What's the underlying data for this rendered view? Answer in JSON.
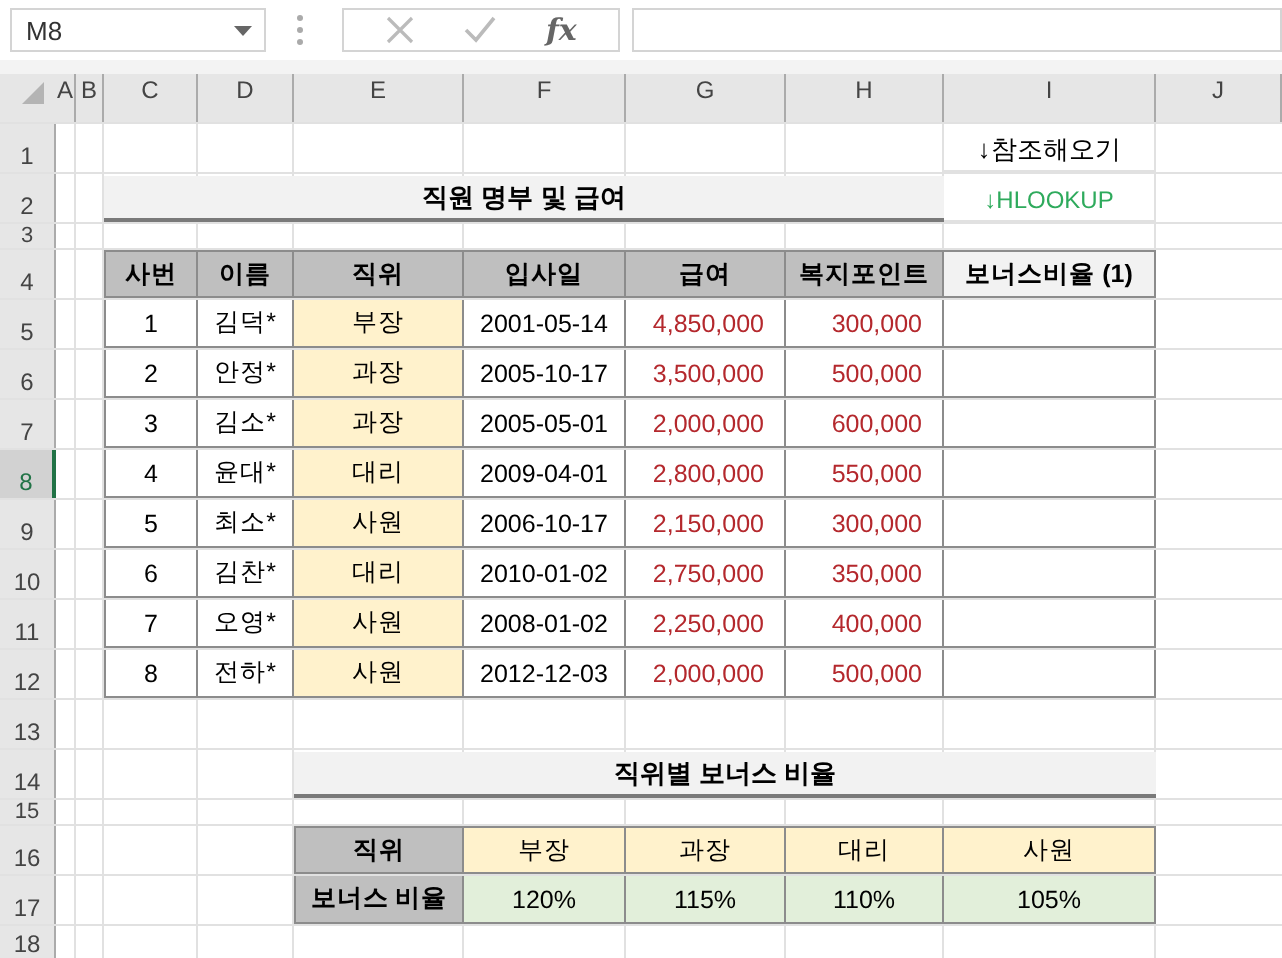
{
  "toolbar": {
    "name_box": "M8",
    "function_label": "fx"
  },
  "columns": [
    {
      "label": "A",
      "selected": false
    },
    {
      "label": "B",
      "selected": false
    },
    {
      "label": "C",
      "selected": false
    },
    {
      "label": "D",
      "selected": false
    },
    {
      "label": "E",
      "selected": false
    },
    {
      "label": "F",
      "selected": false
    },
    {
      "label": "G",
      "selected": false
    },
    {
      "label": "H",
      "selected": false
    },
    {
      "label": "I",
      "selected": false
    },
    {
      "label": "J",
      "selected": false
    }
  ],
  "rows": [
    {
      "label": "1",
      "selected": false
    },
    {
      "label": "2",
      "selected": false
    },
    {
      "label": "3",
      "selected": false
    },
    {
      "label": "4",
      "selected": false
    },
    {
      "label": "5",
      "selected": false
    },
    {
      "label": "6",
      "selected": false
    },
    {
      "label": "7",
      "selected": false
    },
    {
      "label": "8",
      "selected": true
    },
    {
      "label": "9",
      "selected": false
    },
    {
      "label": "10",
      "selected": false
    },
    {
      "label": "11",
      "selected": false
    },
    {
      "label": "12",
      "selected": false
    },
    {
      "label": "13",
      "selected": false
    },
    {
      "label": "14",
      "selected": false
    },
    {
      "label": "15",
      "selected": false
    },
    {
      "label": "16",
      "selected": false
    },
    {
      "label": "17",
      "selected": false
    },
    {
      "label": "18",
      "selected": false
    }
  ],
  "notes": [
    {
      "text": "↓참조해오기",
      "kind": "plain"
    },
    {
      "text": "↓HLOOKUP",
      "kind": "hint"
    }
  ],
  "staff_title": "직원 명부 및 급여",
  "staff_table": {
    "columns": [
      {
        "label": "사번",
        "kind": "number"
      },
      {
        "label": "이름",
        "kind": "name"
      },
      {
        "label": "직위",
        "kind": "position"
      },
      {
        "label": "입사일",
        "kind": "date"
      },
      {
        "label": "급여",
        "kind": "money"
      },
      {
        "label": "복지포인트",
        "kind": "money"
      },
      {
        "label": "보너스비율 (1)",
        "kind": "result"
      }
    ],
    "rows": [
      [
        "1",
        "김덕*",
        "부장",
        "2001-05-14",
        "4,850,000",
        "300,000"
      ],
      [
        "2",
        "안정*",
        "과장",
        "2005-10-17",
        "3,500,000",
        "500,000"
      ],
      [
        "3",
        "김소*",
        "과장",
        "2005-05-01",
        "2,000,000",
        "600,000"
      ],
      [
        "4",
        "윤대*",
        "대리",
        "2009-04-01",
        "2,800,000",
        "550,000"
      ],
      [
        "5",
        "최소*",
        "사원",
        "2006-10-17",
        "2,150,000",
        "300,000"
      ],
      [
        "6",
        "김찬*",
        "대리",
        "2010-01-02",
        "2,750,000",
        "350,000"
      ],
      [
        "7",
        "오영*",
        "사원",
        "2008-01-02",
        "2,250,000",
        "400,000"
      ],
      [
        "8",
        "전하*",
        "사원",
        "2012-12-03",
        "2,000,000",
        "500,000"
      ]
    ]
  },
  "bonus_title": "직위별 보너스 비율",
  "bonus_table": {
    "header_label": "직위",
    "positions": [
      "부장",
      "과장",
      "대리",
      "사원"
    ],
    "rate_label": "보너스 비율",
    "rates": [
      "120%",
      "115%",
      "110%",
      "105%"
    ]
  }
}
